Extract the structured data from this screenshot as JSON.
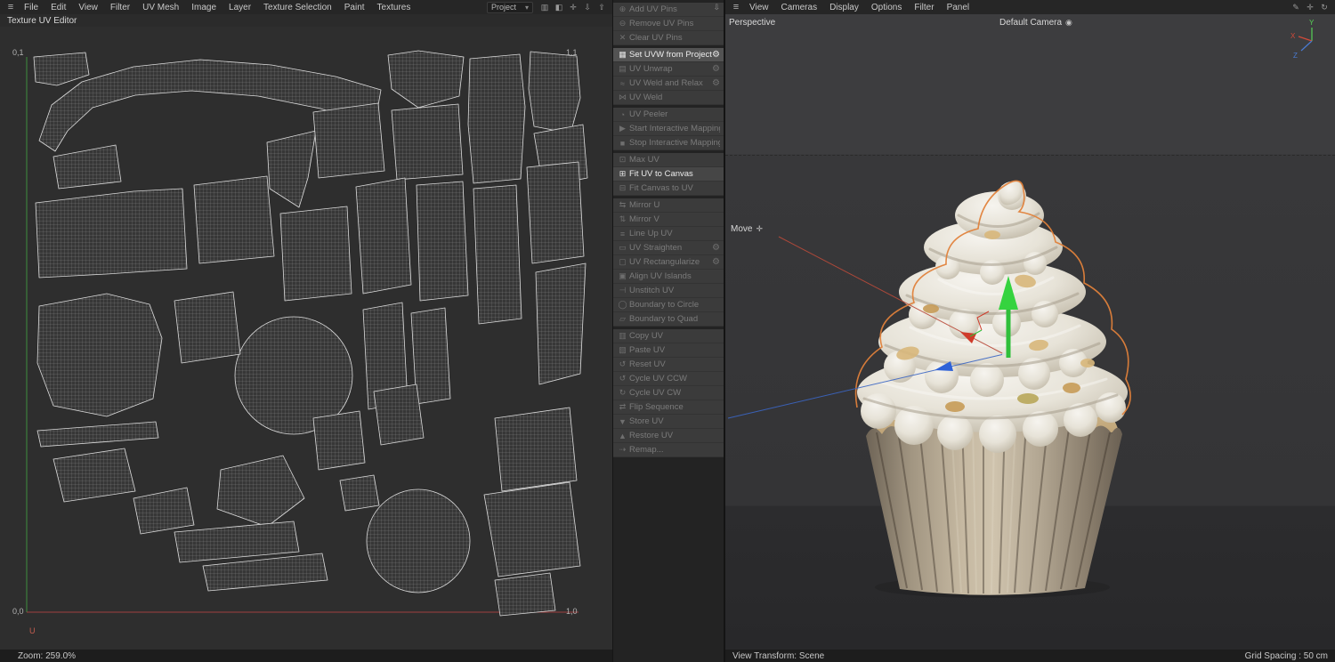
{
  "left_menu": {
    "items": [
      "File",
      "Edit",
      "View",
      "Filter",
      "UV Mesh",
      "Image",
      "Layer",
      "Texture Selection",
      "Paint",
      "Textures"
    ],
    "project_select": "Project"
  },
  "left_panel": {
    "title": "Texture UV Editor",
    "corner_top_left": "0,1",
    "corner_top_right": "1,1",
    "corner_bottom_left": "0,0",
    "corner_bottom_right": "1,0",
    "u_axis_label": "U",
    "zoom_status": "Zoom: 259.0%"
  },
  "uv_toolbar": {
    "gear_glyph": "⚙",
    "icon_glyphs": {
      "pin-add-icon": "⊕",
      "pin-remove-icon": "⊖",
      "pin-clear-icon": "✕",
      "projection-icon": "▦",
      "unwrap-icon": "▤",
      "weld-relax-icon": "≈",
      "weld-icon": "⋈",
      "peeler-icon": "◔",
      "start-icon": "▶",
      "stop-icon": "■",
      "max-uv-icon": "⊡",
      "fit-uv-canvas-icon": "⊞",
      "fit-canvas-uv-icon": "⊟",
      "mirror-u-icon": "⇆",
      "mirror-v-icon": "⇅",
      "lineup-icon": "≡",
      "straighten-icon": "▭",
      "rectangularize-icon": "▢",
      "align-islands-icon": "▣",
      "unstitch-icon": "⊣",
      "boundary-circle-icon": "◯",
      "boundary-quad-icon": "▱",
      "copy-icon": "▥",
      "paste-icon": "▧",
      "reset-icon": "↺",
      "cycle-ccw-icon": "↺",
      "cycle-cw-icon": "↻",
      "flip-seq-icon": "⇄",
      "store-icon": "▼",
      "restore-icon": "▲",
      "remap-icon": "⇢"
    },
    "groups": [
      [
        {
          "label": "Add UV Pins",
          "icon": "pin-add-icon",
          "enabled": false
        },
        {
          "label": "Remove UV Pins",
          "icon": "pin-remove-icon",
          "enabled": false
        },
        {
          "label": "Clear UV Pins",
          "icon": "pin-clear-icon",
          "enabled": false
        }
      ],
      [
        {
          "label": "Set UVW from Projection",
          "icon": "projection-icon",
          "enabled": true,
          "highlighted": true,
          "gear": true
        },
        {
          "label": "UV Unwrap",
          "icon": "unwrap-icon",
          "enabled": false,
          "gear": true
        },
        {
          "label": "UV Weld and Relax",
          "icon": "weld-relax-icon",
          "enabled": false,
          "gear": true
        },
        {
          "label": "UV Weld",
          "icon": "weld-icon",
          "enabled": false
        }
      ],
      [
        {
          "label": "UV Peeler",
          "icon": "peeler-icon",
          "enabled": false
        },
        {
          "label": "Start Interactive Mapping",
          "icon": "start-icon",
          "enabled": false
        },
        {
          "label": "Stop Interactive Mapping",
          "icon": "stop-icon",
          "enabled": false
        }
      ],
      [
        {
          "label": "Max UV",
          "icon": "max-uv-icon",
          "enabled": false
        },
        {
          "label": "Fit UV to Canvas",
          "icon": "fit-uv-canvas-icon",
          "enabled": true
        },
        {
          "label": "Fit Canvas to UV",
          "icon": "fit-canvas-uv-icon",
          "enabled": false
        }
      ],
      [
        {
          "label": "Mirror U",
          "icon": "mirror-u-icon",
          "enabled": false
        },
        {
          "label": "Mirror V",
          "icon": "mirror-v-icon",
          "enabled": false
        },
        {
          "label": "Line Up UV",
          "icon": "lineup-icon",
          "enabled": false
        },
        {
          "label": "UV Straighten",
          "icon": "straighten-icon",
          "enabled": false,
          "gear": true
        },
        {
          "label": "UV Rectangularize",
          "icon": "rectangularize-icon",
          "enabled": false,
          "gear": true
        },
        {
          "label": "Align UV Islands",
          "icon": "align-islands-icon",
          "enabled": false
        },
        {
          "label": "Unstitch UV",
          "icon": "unstitch-icon",
          "enabled": false
        },
        {
          "label": "Boundary to Circle",
          "icon": "boundary-circle-icon",
          "enabled": false
        },
        {
          "label": "Boundary to Quad",
          "icon": "boundary-quad-icon",
          "enabled": false
        }
      ],
      [
        {
          "label": "Copy UV",
          "icon": "copy-icon",
          "enabled": false
        },
        {
          "label": "Paste UV",
          "icon": "paste-icon",
          "enabled": false
        },
        {
          "label": "Reset UV",
          "icon": "reset-icon",
          "enabled": false
        },
        {
          "label": "Cycle UV CCW",
          "icon": "cycle-ccw-icon",
          "enabled": false
        },
        {
          "label": "Cycle UV CW",
          "icon": "cycle-cw-icon",
          "enabled": false
        },
        {
          "label": "Flip Sequence",
          "icon": "flip-seq-icon",
          "enabled": false
        },
        {
          "label": "Store UV",
          "icon": "store-icon",
          "enabled": false
        },
        {
          "label": "Restore UV",
          "icon": "restore-icon",
          "enabled": false
        },
        {
          "label": "Remap...",
          "icon": "remap-icon",
          "enabled": false
        }
      ]
    ]
  },
  "viewport": {
    "menu_items": [
      "View",
      "Cameras",
      "Display",
      "Options",
      "Filter",
      "Panel"
    ],
    "projection_label": "Perspective",
    "camera_label": "Default Camera",
    "tool_label": "Move",
    "status_left": "View Transform: Scene",
    "status_right": "Grid Spacing : 50 cm",
    "axis_x": "X",
    "axis_y": "Y",
    "axis_z": "Z"
  },
  "icons": {
    "hamburger": "≡",
    "histogram": "▥",
    "bucket": "◧",
    "pan": "✛",
    "import": "⇩",
    "export": "⇧",
    "camera": "◉",
    "brush": "✎",
    "orbit": "↻",
    "move-cross": "✛",
    "caret-down": "▾",
    "panel-menu": "⇩"
  },
  "colors": {
    "selection_outline": "#e0813a",
    "axis_x_color": "#d24a3a",
    "axis_y_color": "#57d257",
    "axis_z_color": "#4a7bd2"
  }
}
